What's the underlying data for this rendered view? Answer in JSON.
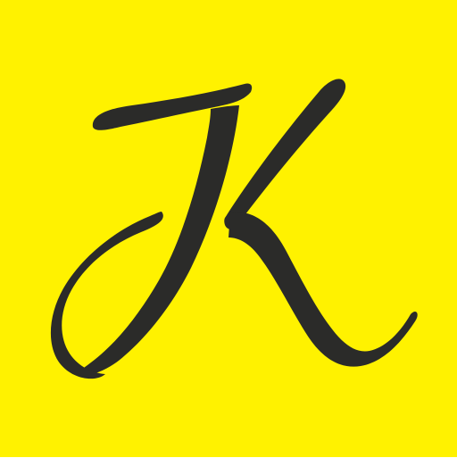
{
  "icon": {
    "name": "k-monogram-icon",
    "logo_text": "K",
    "colors": {
      "background": "#FFF200",
      "glyph": "#2B2B29"
    }
  }
}
